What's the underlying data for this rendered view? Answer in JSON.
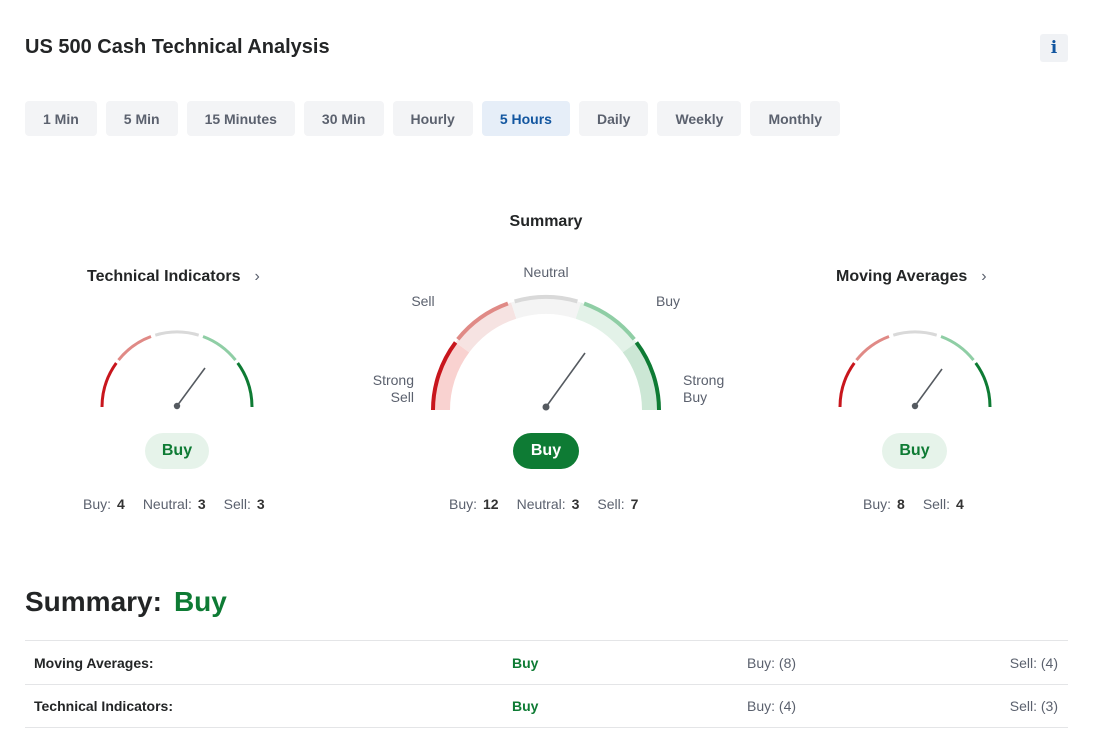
{
  "header": {
    "title": "US 500 Cash Technical Analysis",
    "info_icon": "i"
  },
  "tabs": [
    {
      "label": "1 Min",
      "active": false
    },
    {
      "label": "5 Min",
      "active": false
    },
    {
      "label": "15 Minutes",
      "active": false
    },
    {
      "label": "30 Min",
      "active": false
    },
    {
      "label": "Hourly",
      "active": false
    },
    {
      "label": "5 Hours",
      "active": true
    },
    {
      "label": "Daily",
      "active": false
    },
    {
      "label": "Weekly",
      "active": false
    },
    {
      "label": "Monthly",
      "active": false
    }
  ],
  "summary_gauge": {
    "title": "Summary",
    "labels": {
      "neutral": "Neutral",
      "sell": "Sell",
      "buy": "Buy",
      "strong_sell": "Strong\nSell",
      "strong_buy": "Strong\nBuy"
    },
    "result": "Buy",
    "counts": {
      "buy_label": "Buy:",
      "buy": "12",
      "neutral_label": "Neutral:",
      "neutral": "3",
      "sell_label": "Sell:",
      "sell": "7"
    }
  },
  "technical_indicators": {
    "title": "Technical Indicators",
    "chevron": "›",
    "result": "Buy",
    "counts": {
      "buy_label": "Buy:",
      "buy": "4",
      "neutral_label": "Neutral:",
      "neutral": "3",
      "sell_label": "Sell:",
      "sell": "3"
    }
  },
  "moving_averages": {
    "title": "Moving Averages",
    "chevron": "›",
    "result": "Buy",
    "counts": {
      "buy_label": "Buy:",
      "buy": "8",
      "sell_label": "Sell:",
      "sell": "4"
    }
  },
  "summary": {
    "label": "Summary:",
    "value": "Buy",
    "rows": [
      {
        "name": "Moving Averages:",
        "result": "Buy",
        "buy": "Buy: (8)",
        "sell": "Sell: (4)"
      },
      {
        "name": "Technical Indicators:",
        "result": "Buy",
        "buy": "Buy: (4)",
        "sell": "Sell: (3)"
      }
    ]
  },
  "colors": {
    "strong_sell": "#c8161d",
    "sell": "#e08a86",
    "neutral": "#d9d9d9",
    "buy": "#8fcea5",
    "strong_buy": "#0e7b34",
    "accent": "#1256a0"
  }
}
